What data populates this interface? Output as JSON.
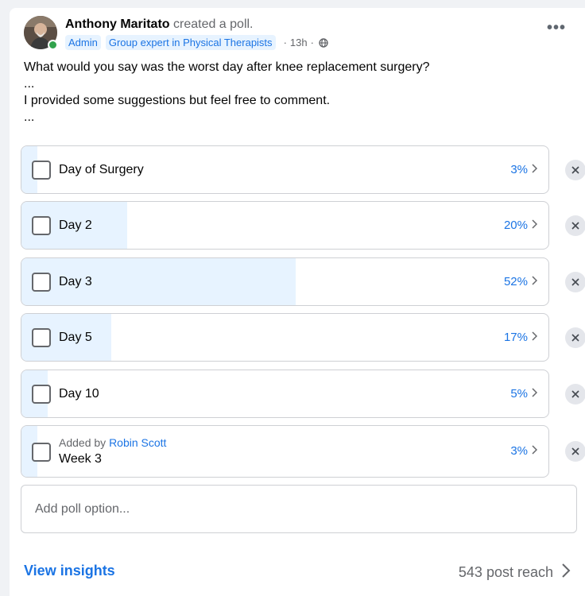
{
  "post": {
    "author": "Anthony Maritato",
    "action": " created a poll.",
    "badges": [
      "Admin",
      "Group expert in Physical Therapists"
    ],
    "time": "13h",
    "more_label": "•••",
    "text": [
      "What would you say was the worst day after knee replacement surgery?",
      "...",
      "I provided some suggestions but feel free to comment.",
      "..."
    ]
  },
  "poll": {
    "options": [
      {
        "label": "Day of Surgery",
        "percent_label": "3%",
        "percent": 3
      },
      {
        "label": "Day 2",
        "percent_label": "20%",
        "percent": 20
      },
      {
        "label": "Day 3",
        "percent_label": "52%",
        "percent": 52
      },
      {
        "label": "Day 5",
        "percent_label": "17%",
        "percent": 17
      },
      {
        "label": "Day 10",
        "percent_label": "5%",
        "percent": 5
      },
      {
        "label": "Week 3",
        "percent_label": "3%",
        "percent": 3,
        "added_by_prefix": "Added by ",
        "added_by": "Robin Scott"
      }
    ],
    "add_option_placeholder": "Add poll option..."
  },
  "footer": {
    "insights_label": "View insights",
    "reach_label": "543 post reach"
  },
  "icons": {
    "remove": "close-icon",
    "chevron": "chevron-right-icon",
    "privacy": "globe-icon"
  },
  "colors": {
    "accent": "#1b74e4",
    "fill": "#e7f3ff",
    "online": "#31a24c"
  }
}
